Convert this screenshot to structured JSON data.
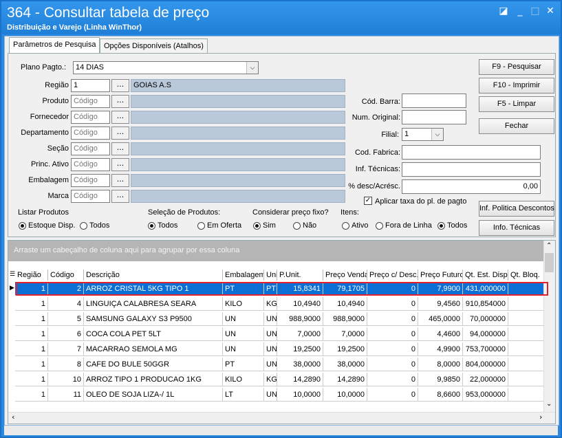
{
  "window": {
    "title": "364 - Consultar tabela de preço",
    "subtitle": "Distribuição e Varejo (Linha WinThor)"
  },
  "tabs": [
    "Parâmetros de Pesquisa",
    "Opções Disponíveis (Atalhos)"
  ],
  "form": {
    "plano_pagto_label": "Plano Pagto.:",
    "plano_pagto_value": "14 DIAS",
    "regiao_label": "Região",
    "regiao_value": "1",
    "regiao_desc": "GOIAS A.S",
    "produto_label": "Produto",
    "fornecedor_label": "Fornecedor",
    "departamento_label": "Departamento",
    "secao_label": "Seção",
    "princ_ativo_label": "Princ. Ativo",
    "embalagem_label": "Embalagem",
    "marca_label": "Marca",
    "codigo_placeholder": "Código",
    "dots": "...",
    "cod_barra_label": "Cód. Barra:",
    "num_original_label": "Num. Original:",
    "filial_label": "Filial:",
    "filial_value": "1",
    "cod_fabrica_label": "Cod. Fabrica:",
    "inf_tecnicas_label": "Inf. Técnicas:",
    "desc_acresc_label": "% desc/Acrésc.",
    "desc_acresc_value": "0,00",
    "aplicar_taxa_label": "Aplicar taxa do pl. de pagto"
  },
  "buttons": {
    "pesquisar": "F9 - Pesquisar",
    "imprimir": "F10 - Imprimir",
    "limpar": "F5 - Limpar",
    "fechar": "Fechar",
    "inf_politica": "Inf. Politica Descontos",
    "info_tecnicas": "Info. Técnicas"
  },
  "options": {
    "listar_title": "Listar Produtos",
    "listar": [
      "Estoque Disp.",
      "Todos"
    ],
    "selecao_title": "Seleção de Produtos:",
    "selecao": [
      "Todos",
      "Em Oferta"
    ],
    "preco_fixo_title": "Considerar preço fixo?",
    "preco_fixo": [
      "Sim",
      "Não"
    ],
    "itens_title": "Itens:",
    "itens": [
      "Ativo",
      "Fora de Linha",
      "Todos"
    ]
  },
  "grid": {
    "group_hint": "Arraste um cabeçalho de coluna aqui para agrupar por essa coluna",
    "columns": [
      "Região",
      "Código",
      "Descrição",
      "Embalagem",
      "Uni",
      "P.Unit.",
      "Preço Venda",
      "Preço c/ Desc.",
      "Preço Futuro",
      "Qt. Est. Disp",
      "Qt. Bloq."
    ],
    "rows": [
      [
        "1",
        "2",
        "ARROZ CRISTAL 5KG TIPO 1",
        "PT",
        "PT",
        "15,8341",
        "79,1705",
        "0",
        "7,9900",
        "431,000000",
        ""
      ],
      [
        "1",
        "4",
        "LINGUIÇA CALABRESA SEARA",
        "KILO",
        "KG",
        "10,4940",
        "10,4940",
        "0",
        "9,4560",
        "910,854000",
        ""
      ],
      [
        "1",
        "5",
        "SAMSUNG GALAXY S3 P9500",
        "UN",
        "UN",
        "988,9000",
        "988,9000",
        "0",
        "465,0000",
        "70,000000",
        ""
      ],
      [
        "1",
        "6",
        "COCA COLA PET 5LT",
        "UN",
        "UN",
        "7,0000",
        "7,0000",
        "0",
        "4,4600",
        "94,000000",
        ""
      ],
      [
        "1",
        "7",
        "MACARRAO SEMOLA MG",
        "UN",
        "UN",
        "19,2500",
        "19,2500",
        "0",
        "4,9900",
        "753,700000",
        ""
      ],
      [
        "1",
        "8",
        "CAFE DO BULE 50GGR",
        "PT",
        "UN",
        "38,0000",
        "38,0000",
        "0",
        "8,0000",
        "804,000000",
        ""
      ],
      [
        "1",
        "10",
        "ARROZ TIPO 1 PRODUCAO 1KG",
        "KILO",
        "KG",
        "14,2890",
        "14,2890",
        "0",
        "9,9850",
        "22,000000",
        ""
      ],
      [
        "1",
        "11",
        "OLEO DE SOJA LIZA-/ 1L",
        "LT",
        "UN",
        "10,0000",
        "10,0000",
        "0",
        "8,6600",
        "953,000000",
        ""
      ]
    ]
  },
  "colors": {
    "title_bar": "#1f7fd8",
    "selection": "#0b6fd6",
    "highlight_border": "#e0202a"
  }
}
